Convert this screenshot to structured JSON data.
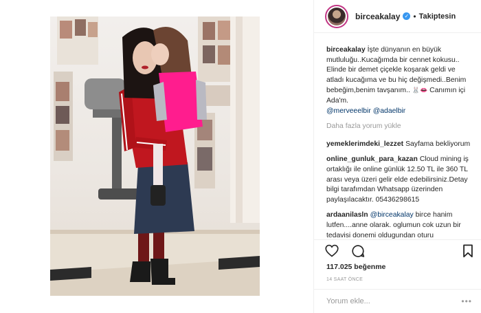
{
  "post": {
    "username": "birceakalay",
    "verified_icon": "verified-badge-icon",
    "separator": "•",
    "follow_status": "Takiptesin",
    "likes": "117.025 beğenme",
    "timestamp": "14 SAAT ÖNCE"
  },
  "caption": {
    "user": "birceakalay",
    "text": "İşte dünyanın en büyük mutluluğu..Kucağımda bir cennet kokusu.. Elinde bir demet çiçekle koşarak geldi ve atladı kucağıma ve bu hiç değişmedi..Benim bebeğim,benim tavşanım..",
    "text_after_emoji": "Canımın içi Ada'm.",
    "mention1": "@merveeelbir",
    "mention2": "@adaelbir"
  },
  "load_more": "Daha fazla yorum yükle",
  "comments": [
    {
      "user": "yemeklerimdeki_lezzet",
      "text": "Sayfama bekliyorum"
    },
    {
      "user": "online_gunluk_para_kazan",
      "text": "Cloud mining iş ortaklığı ile online günlük 12.50 TL ile 360 TL arası veya üzeri gelir elde edebilirsiniz.Detay bilgi tarafımdan Whatsapp üzerinden paylaşılacaktır. 05436298615"
    },
    {
      "user": "ardaanilasln",
      "mention": "@birceakalay",
      "text": "birce hanim lutfen....anne olarak. oglumun cok uzun bir tedavisi donemi oldugundan oturu"
    }
  ],
  "comment_box": {
    "placeholder": "Yorum ekle...",
    "more": "•••"
  },
  "colors": {
    "accent_link": "#003569",
    "verified": "#3897f0",
    "muted": "#999999",
    "border": "#efefef"
  }
}
